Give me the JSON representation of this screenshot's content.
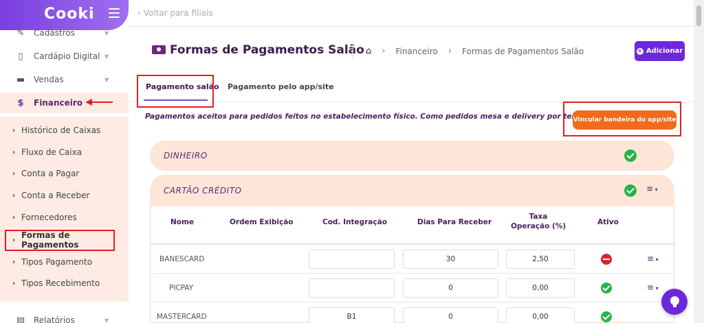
{
  "app": {
    "logo": "Cooki"
  },
  "sidebar": {
    "items": [
      {
        "label": "Cadastros",
        "icon": "edit-icon"
      },
      {
        "label": "Cardápio Digital",
        "icon": "tablet-icon"
      },
      {
        "label": "Vendas",
        "icon": "money-icon"
      },
      {
        "label": "Financeiro",
        "icon": "dollar-icon"
      }
    ],
    "subitems": [
      {
        "label": "Histórico de Caixas"
      },
      {
        "label": "Fluxo de Caixa"
      },
      {
        "label": "Conta a Pagar"
      },
      {
        "label": "Conta a Receber"
      },
      {
        "label": "Fornecedores"
      },
      {
        "label": "Formas de Pagamentos"
      },
      {
        "label": "Tipos Pagamento"
      },
      {
        "label": "Tipos Recebimento"
      }
    ],
    "bottom_item": {
      "label": "Relatórios",
      "icon": "report-icon"
    }
  },
  "topbar": {
    "back_label": "Voltar para filiais"
  },
  "header": {
    "title": "Formas de Pagamentos Salão",
    "breadcrumb": [
      "Financeiro",
      "Formas de Pagamentos Salão"
    ],
    "add_label": "Adicionar"
  },
  "tabs": [
    {
      "label": "Pagamento salão"
    },
    {
      "label": "Pagamento pelo app/site"
    }
  ],
  "description": "Pagamentos aceitos para pedidos feitos no estabelecimento físico. Como pedidos mesa e delivery por telefone.",
  "link_button": "Vincular bandeira do app/site",
  "accordions": [
    {
      "label": "DINHEIRO",
      "active": true
    },
    {
      "label": "CARTÃO CRÉDITO",
      "active": true
    }
  ],
  "table": {
    "headers": {
      "nome": "Nome",
      "ordem": "Ordem Exibição",
      "cod": "Cod. Integração",
      "dias": "Dias Para Receber",
      "taxa_line1": "Taxa",
      "taxa_line2": "Operação (%)",
      "ativo": "Ativo"
    },
    "rows": [
      {
        "name": "BANESCARD",
        "cod": "",
        "dias": "30",
        "taxa": "2,50",
        "ativo": false
      },
      {
        "name": "PICPAY",
        "cod": "",
        "dias": "0",
        "taxa": "0,00",
        "ativo": true
      },
      {
        "name": "MASTERCARD",
        "cod": "B1",
        "dias": "0",
        "taxa": "0,00",
        "ativo": true
      }
    ]
  },
  "colors": {
    "brand": "#6c28d9",
    "accent_orange": "#f26a1b",
    "sidebar_highlight": "#fdebe4",
    "success": "#28b34a",
    "danger": "#d9252c"
  }
}
